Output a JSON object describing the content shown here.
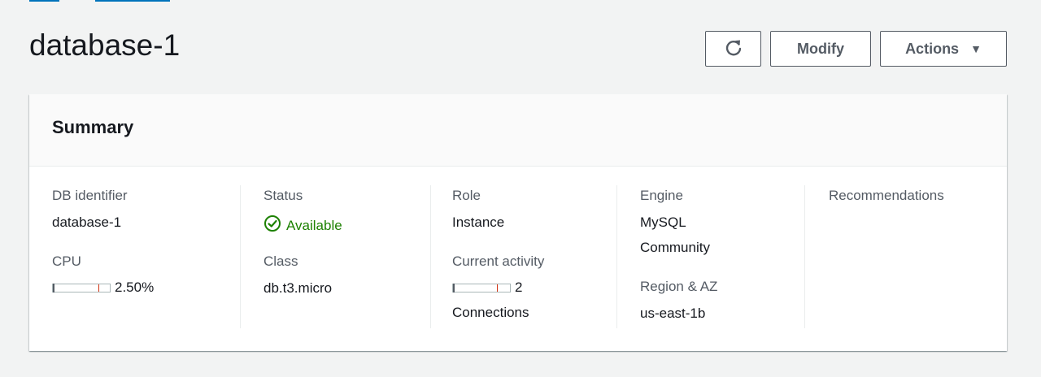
{
  "page": {
    "title": "database-1"
  },
  "toolbar": {
    "refresh_icon": "refresh-icon",
    "modify_label": "Modify",
    "actions_label": "Actions",
    "actions_caret": "▼"
  },
  "summary": {
    "title": "Summary",
    "db_identifier": {
      "label": "DB identifier",
      "value": "database-1"
    },
    "cpu": {
      "label": "CPU",
      "value": "2.50%",
      "fraction": 0.025
    },
    "status": {
      "label": "Status",
      "value": "Available",
      "color": "#1d8102"
    },
    "class": {
      "label": "Class",
      "value": "db.t3.micro"
    },
    "role": {
      "label": "Role",
      "value": "Instance"
    },
    "current_activity": {
      "label": "Current activity",
      "count": "2",
      "unit": "Connections"
    },
    "engine": {
      "label": "Engine",
      "value_line1": "MySQL",
      "value_line2": "Community"
    },
    "region_az": {
      "label": "Region & AZ",
      "value": "us-east-1b"
    },
    "recommendations": {
      "label": "Recommendations"
    }
  },
  "colors": {
    "link_blue": "#0073bb",
    "success_green": "#1d8102",
    "meter_threshold": "#d13212"
  }
}
